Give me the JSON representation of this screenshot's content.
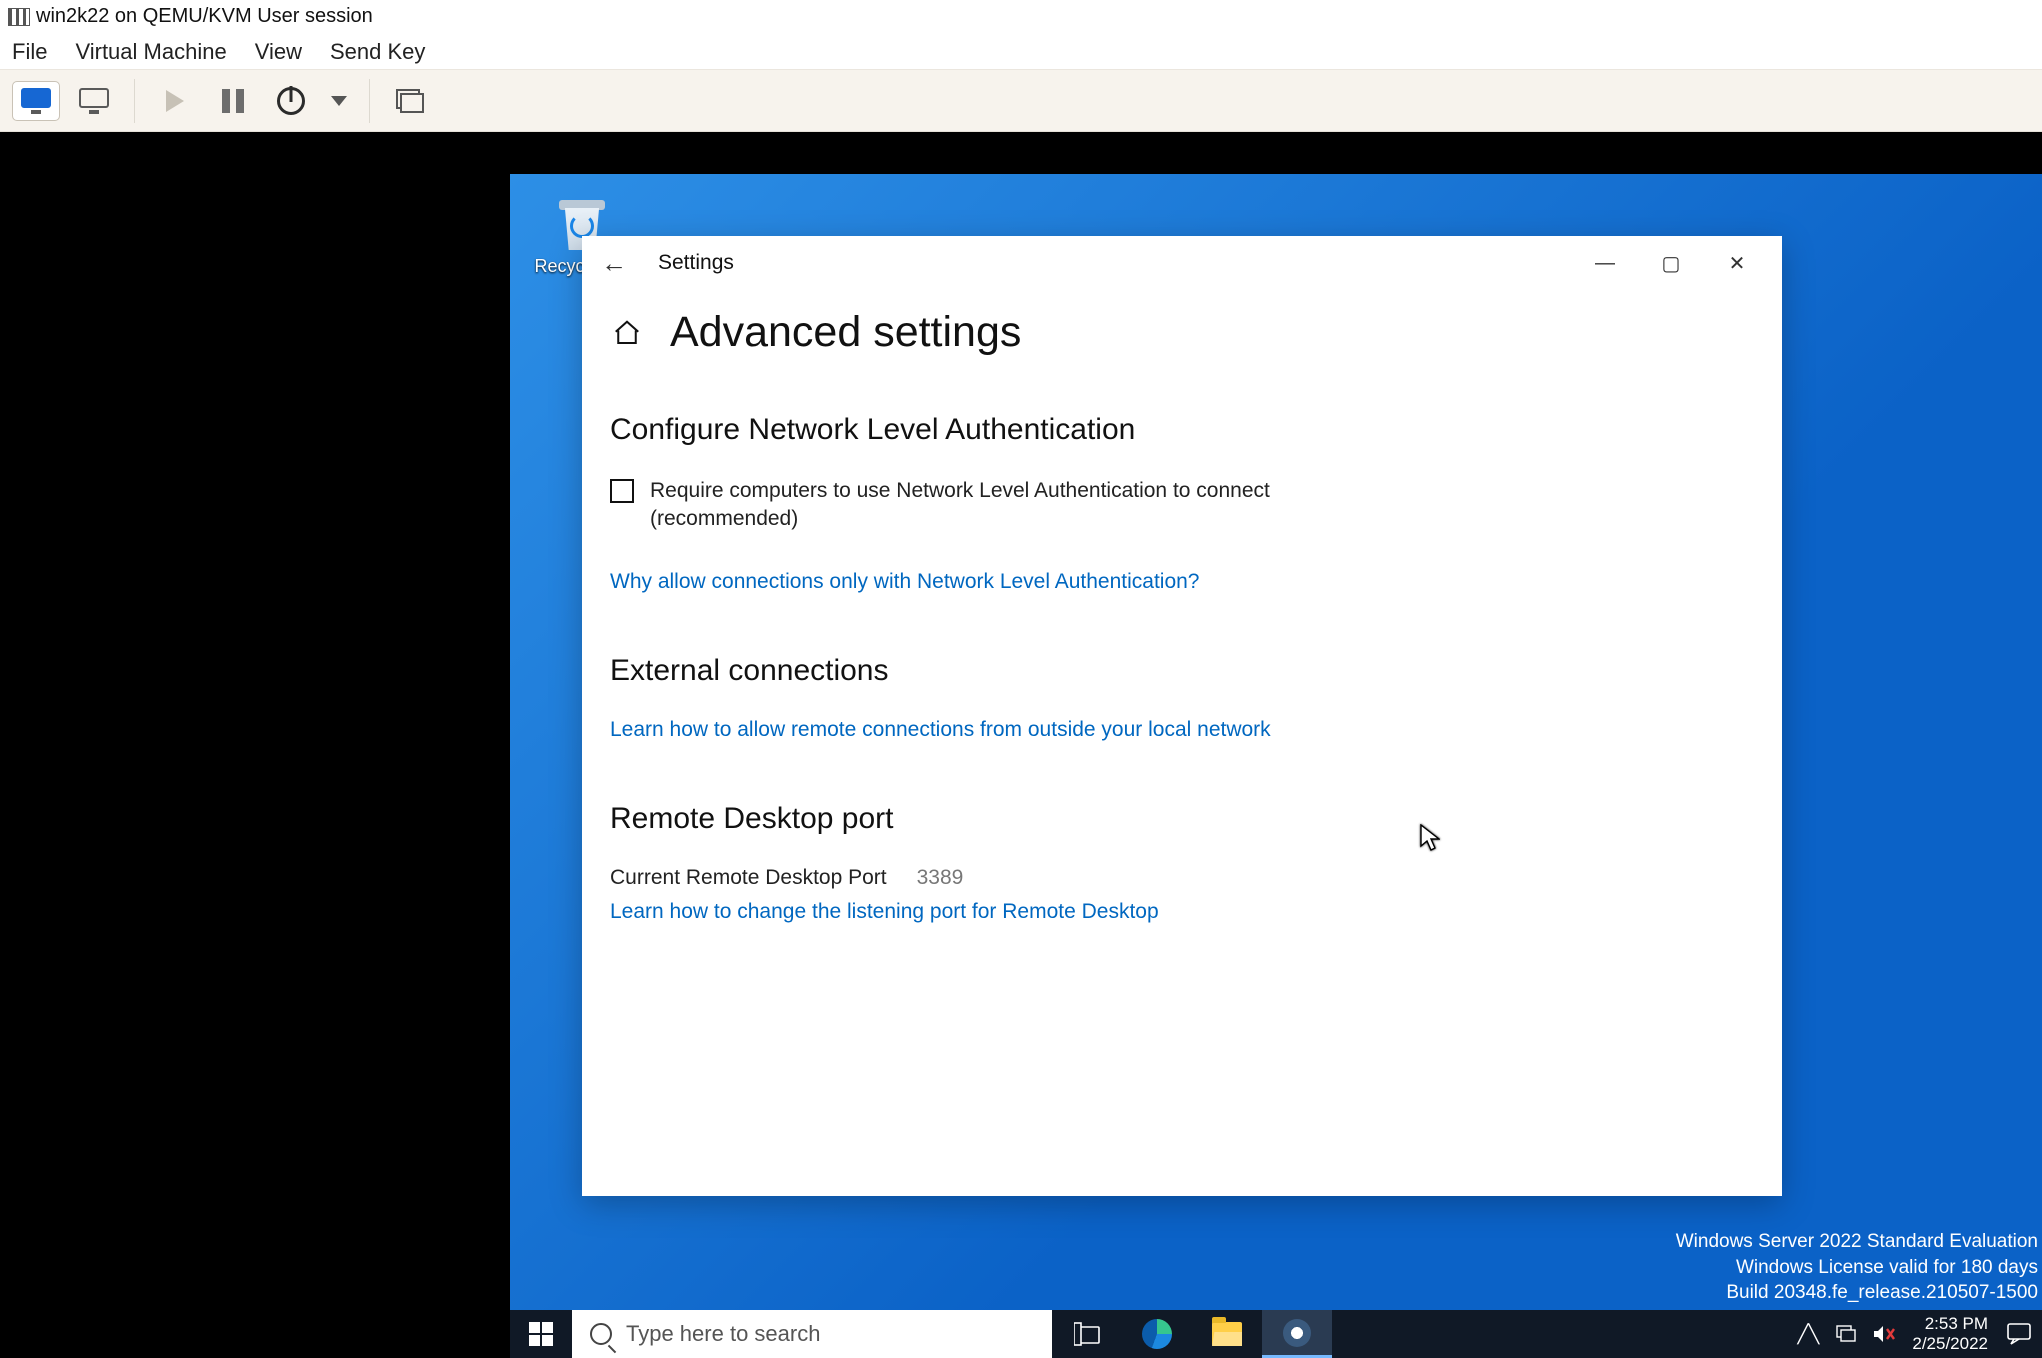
{
  "host": {
    "title": "win2k22 on QEMU/KVM User session",
    "menu": {
      "file": "File",
      "vm": "Virtual Machine",
      "view": "View",
      "sendkey": "Send Key"
    }
  },
  "desktop": {
    "recycle_bin": "Recycle Bin"
  },
  "settings": {
    "window_title": "Settings",
    "page_title": "Advanced settings",
    "section_nla": {
      "heading": "Configure Network Level Authentication",
      "checkbox_label": "Require computers to use Network Level Authentication to connect (recommended)",
      "link": "Why allow connections only with Network Level Authentication?"
    },
    "section_ext": {
      "heading": "External connections",
      "link": "Learn how to allow remote connections from outside your local network"
    },
    "section_port": {
      "heading": "Remote Desktop port",
      "label": "Current Remote Desktop Port",
      "value": "3389",
      "link": "Learn how to change the listening port for Remote Desktop"
    }
  },
  "watermark": {
    "line1": "Windows Server 2022 Standard Evaluation",
    "line2": "Windows License valid for 180 days",
    "line3": "Build 20348.fe_release.210507-1500"
  },
  "taskbar": {
    "search_placeholder": "Type here to search",
    "time": "2:53 PM",
    "date": "2/25/2022"
  }
}
